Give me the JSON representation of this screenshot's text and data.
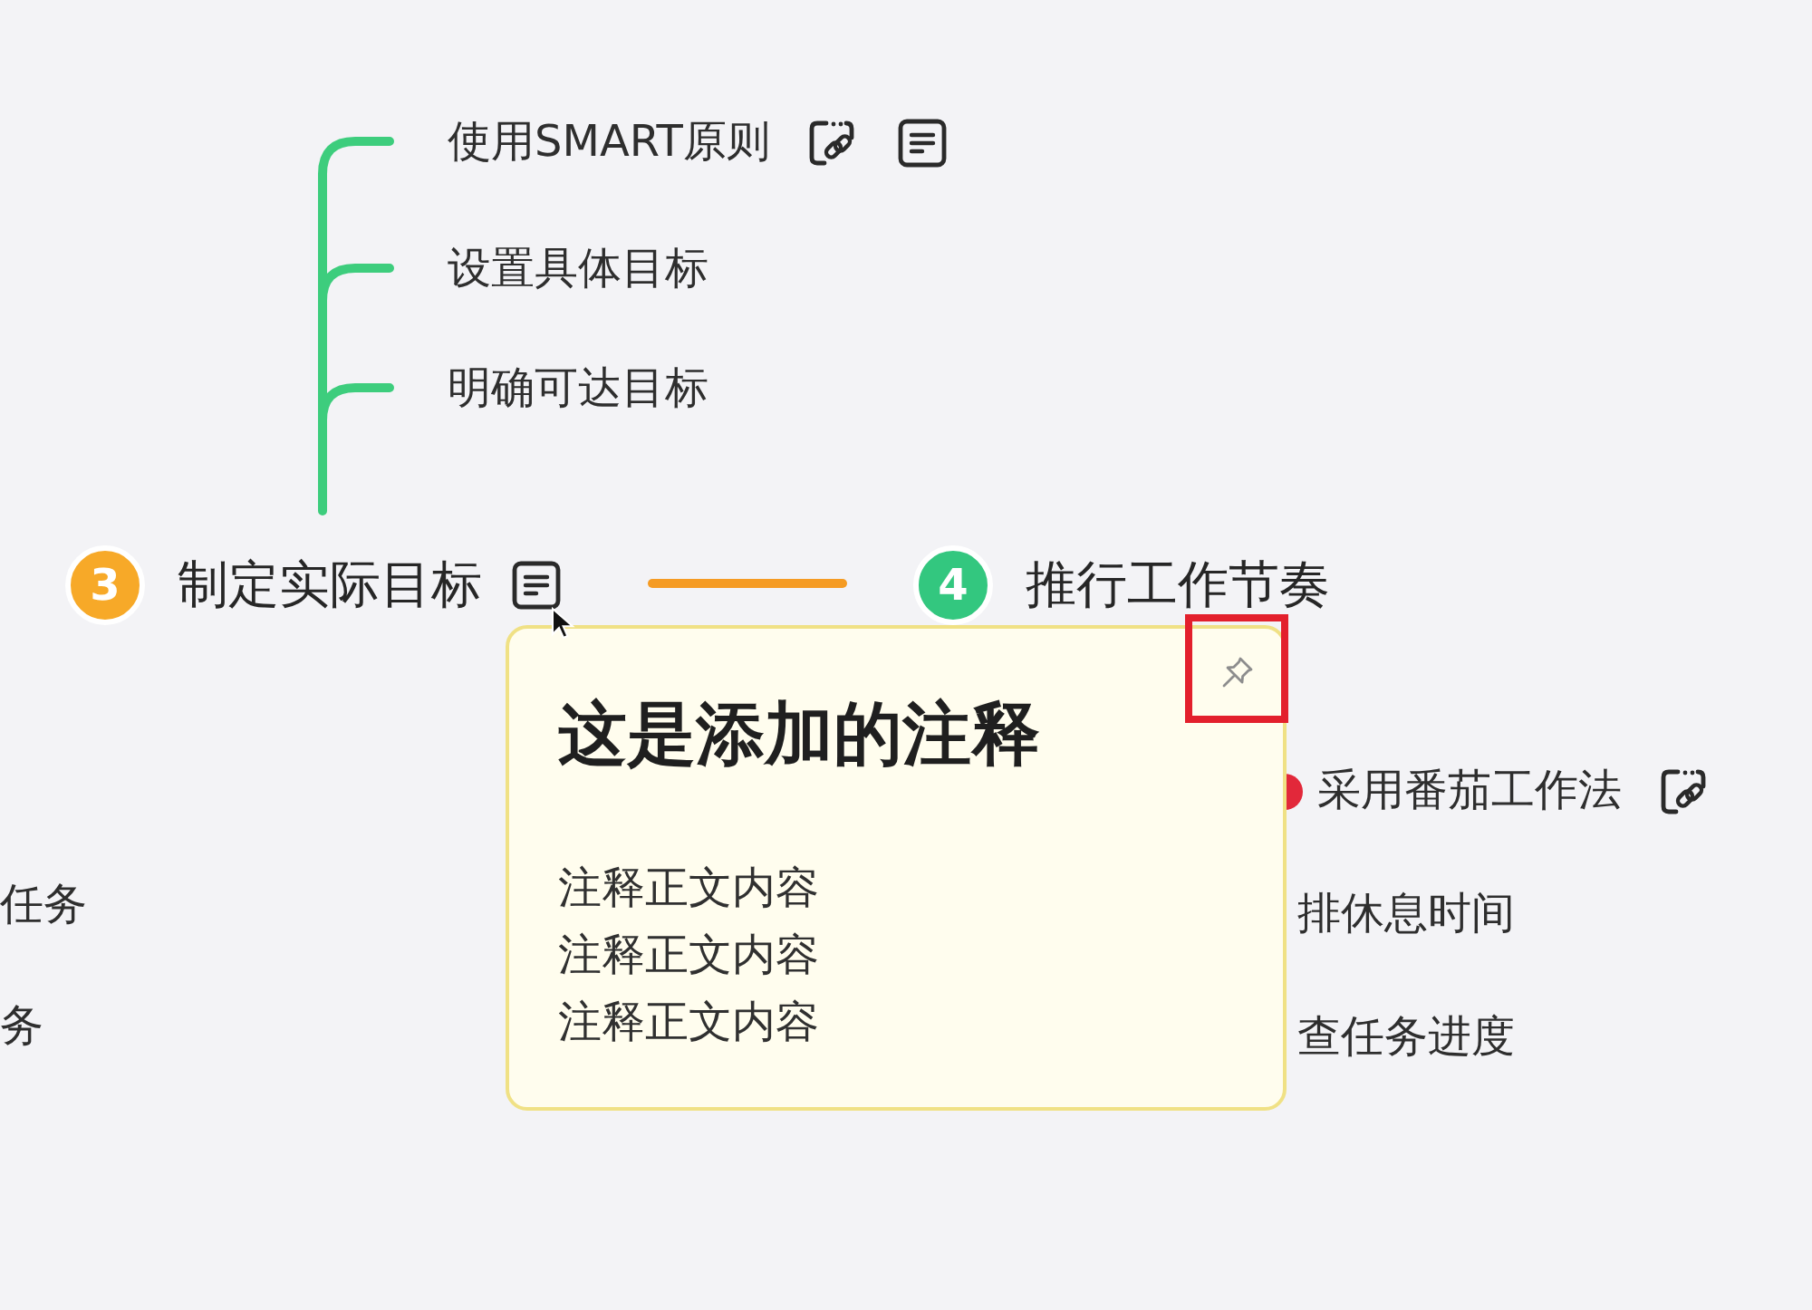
{
  "mind_map": {
    "subtopics": [
      {
        "label": "使用SMART原则",
        "has_link": true,
        "has_note": true
      },
      {
        "label": "设置具体目标",
        "has_link": false,
        "has_note": false
      },
      {
        "label": "明确可达目标",
        "has_link": false,
        "has_note": false
      }
    ],
    "topics": [
      {
        "number": "3",
        "label": "制定实际目标",
        "color": "#f7a928",
        "has_note": true
      },
      {
        "number": "4",
        "label": "推行工作节奏",
        "color": "#33c77f",
        "has_note": false
      }
    ],
    "right_subtopics": [
      {
        "label": "采用番茄工作法",
        "has_marker": true,
        "has_link": true
      },
      {
        "label": "排休息时间",
        "has_marker": false,
        "has_link": false
      },
      {
        "label": "查任务进度",
        "has_marker": false,
        "has_link": false
      }
    ],
    "left_subtopics": [
      {
        "label": "任务"
      },
      {
        "label": "务"
      }
    ]
  },
  "note_popup": {
    "title": "这是添加的注释",
    "body": [
      "注释正文内容",
      "注释正文内容",
      "注释正文内容"
    ],
    "pin_highlighted": true
  }
}
